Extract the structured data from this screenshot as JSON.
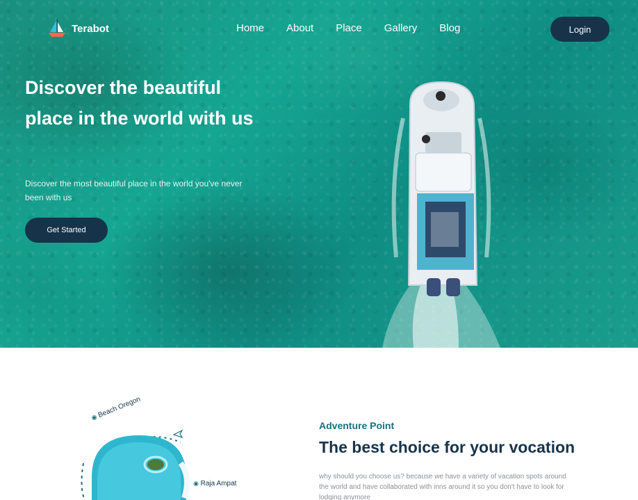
{
  "brand": {
    "name": "Terabot"
  },
  "nav": {
    "items": [
      "Home",
      "About",
      "Place",
      "Gallery",
      "Blog"
    ],
    "login_label": "Login"
  },
  "hero": {
    "title": "Discover the beautiful place in the world with us",
    "subtitle": "Discover the most beautiful place in the world you've never been with us",
    "cta_label": "Get Started"
  },
  "about": {
    "kicker": "Adventure Point",
    "title": "The best choice for your vocation",
    "body": "why should you choose us? because we have a variety of vacation spots around the world and have collaborated with inns around it so you don't have to look for lodging anymore",
    "locations": [
      "Beach Oregon",
      "Raja Ampat"
    ]
  },
  "colors": {
    "accent_dark": "#16334a",
    "accent_teal": "#17727e",
    "sea": "#15a692"
  },
  "icons": {
    "logo": "sailboat-icon",
    "pin": "map-pin-icon",
    "plane": "airplane-icon"
  }
}
